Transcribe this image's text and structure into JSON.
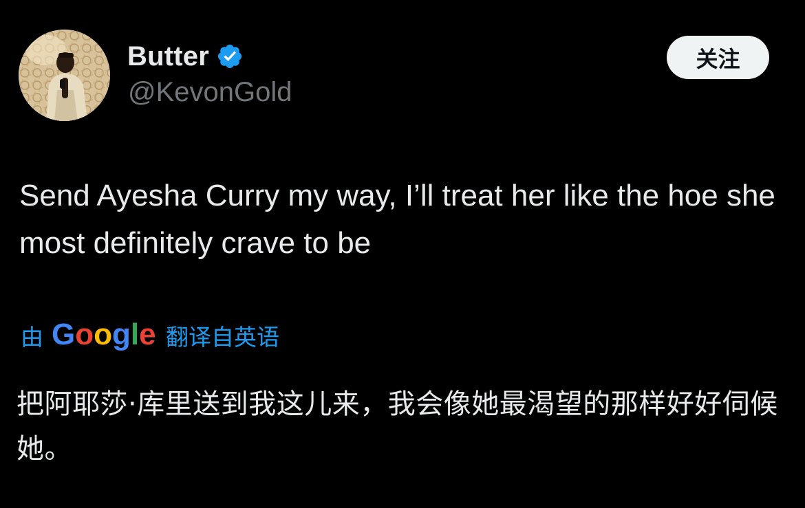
{
  "author": {
    "display_name": "Butter",
    "handle": "@KevonGold",
    "verified": true,
    "verified_color": "#1d9bf0"
  },
  "follow_button": {
    "label": "关注"
  },
  "tweet": {
    "text": "Send Ayesha Curry my way, I’ll treat her like the hoe she most definitely crave to be"
  },
  "translation": {
    "prefix": "由",
    "provider_logo": "Google",
    "suffix": "翻译自英语",
    "text": "把阿耶莎·库里送到我这儿来，我会像她最渴望的那样好好伺候她。"
  },
  "colors": {
    "background": "#000000",
    "primary_text": "#e7e9ea",
    "secondary_text": "#71767b",
    "link": "#1d9bf0"
  }
}
